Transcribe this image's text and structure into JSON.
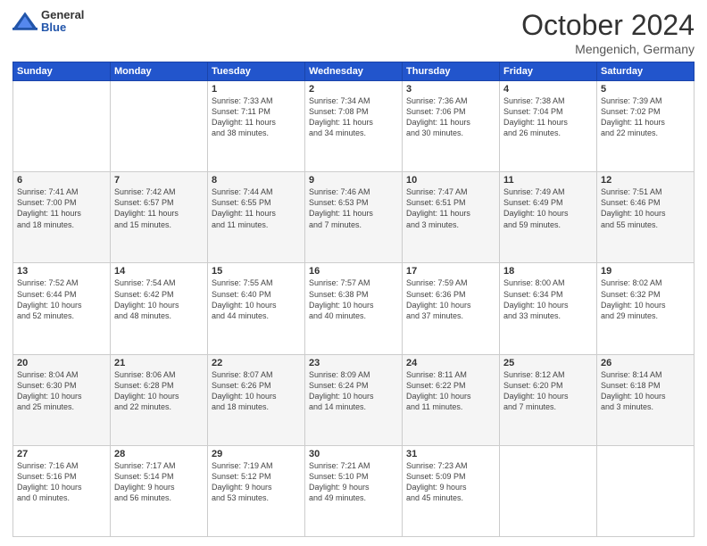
{
  "header": {
    "logo": {
      "general": "General",
      "blue": "Blue"
    },
    "title": "October 2024",
    "location": "Mengenich, Germany"
  },
  "weekdays": [
    "Sunday",
    "Monday",
    "Tuesday",
    "Wednesday",
    "Thursday",
    "Friday",
    "Saturday"
  ],
  "weeks": [
    [
      {
        "day": "",
        "info": ""
      },
      {
        "day": "",
        "info": ""
      },
      {
        "day": "1",
        "info": "Sunrise: 7:33 AM\nSunset: 7:11 PM\nDaylight: 11 hours\nand 38 minutes."
      },
      {
        "day": "2",
        "info": "Sunrise: 7:34 AM\nSunset: 7:08 PM\nDaylight: 11 hours\nand 34 minutes."
      },
      {
        "day": "3",
        "info": "Sunrise: 7:36 AM\nSunset: 7:06 PM\nDaylight: 11 hours\nand 30 minutes."
      },
      {
        "day": "4",
        "info": "Sunrise: 7:38 AM\nSunset: 7:04 PM\nDaylight: 11 hours\nand 26 minutes."
      },
      {
        "day": "5",
        "info": "Sunrise: 7:39 AM\nSunset: 7:02 PM\nDaylight: 11 hours\nand 22 minutes."
      }
    ],
    [
      {
        "day": "6",
        "info": "Sunrise: 7:41 AM\nSunset: 7:00 PM\nDaylight: 11 hours\nand 18 minutes."
      },
      {
        "day": "7",
        "info": "Sunrise: 7:42 AM\nSunset: 6:57 PM\nDaylight: 11 hours\nand 15 minutes."
      },
      {
        "day": "8",
        "info": "Sunrise: 7:44 AM\nSunset: 6:55 PM\nDaylight: 11 hours\nand 11 minutes."
      },
      {
        "day": "9",
        "info": "Sunrise: 7:46 AM\nSunset: 6:53 PM\nDaylight: 11 hours\nand 7 minutes."
      },
      {
        "day": "10",
        "info": "Sunrise: 7:47 AM\nSunset: 6:51 PM\nDaylight: 11 hours\nand 3 minutes."
      },
      {
        "day": "11",
        "info": "Sunrise: 7:49 AM\nSunset: 6:49 PM\nDaylight: 10 hours\nand 59 minutes."
      },
      {
        "day": "12",
        "info": "Sunrise: 7:51 AM\nSunset: 6:46 PM\nDaylight: 10 hours\nand 55 minutes."
      }
    ],
    [
      {
        "day": "13",
        "info": "Sunrise: 7:52 AM\nSunset: 6:44 PM\nDaylight: 10 hours\nand 52 minutes."
      },
      {
        "day": "14",
        "info": "Sunrise: 7:54 AM\nSunset: 6:42 PM\nDaylight: 10 hours\nand 48 minutes."
      },
      {
        "day": "15",
        "info": "Sunrise: 7:55 AM\nSunset: 6:40 PM\nDaylight: 10 hours\nand 44 minutes."
      },
      {
        "day": "16",
        "info": "Sunrise: 7:57 AM\nSunset: 6:38 PM\nDaylight: 10 hours\nand 40 minutes."
      },
      {
        "day": "17",
        "info": "Sunrise: 7:59 AM\nSunset: 6:36 PM\nDaylight: 10 hours\nand 37 minutes."
      },
      {
        "day": "18",
        "info": "Sunrise: 8:00 AM\nSunset: 6:34 PM\nDaylight: 10 hours\nand 33 minutes."
      },
      {
        "day": "19",
        "info": "Sunrise: 8:02 AM\nSunset: 6:32 PM\nDaylight: 10 hours\nand 29 minutes."
      }
    ],
    [
      {
        "day": "20",
        "info": "Sunrise: 8:04 AM\nSunset: 6:30 PM\nDaylight: 10 hours\nand 25 minutes."
      },
      {
        "day": "21",
        "info": "Sunrise: 8:06 AM\nSunset: 6:28 PM\nDaylight: 10 hours\nand 22 minutes."
      },
      {
        "day": "22",
        "info": "Sunrise: 8:07 AM\nSunset: 6:26 PM\nDaylight: 10 hours\nand 18 minutes."
      },
      {
        "day": "23",
        "info": "Sunrise: 8:09 AM\nSunset: 6:24 PM\nDaylight: 10 hours\nand 14 minutes."
      },
      {
        "day": "24",
        "info": "Sunrise: 8:11 AM\nSunset: 6:22 PM\nDaylight: 10 hours\nand 11 minutes."
      },
      {
        "day": "25",
        "info": "Sunrise: 8:12 AM\nSunset: 6:20 PM\nDaylight: 10 hours\nand 7 minutes."
      },
      {
        "day": "26",
        "info": "Sunrise: 8:14 AM\nSunset: 6:18 PM\nDaylight: 10 hours\nand 3 minutes."
      }
    ],
    [
      {
        "day": "27",
        "info": "Sunrise: 7:16 AM\nSunset: 5:16 PM\nDaylight: 10 hours\nand 0 minutes."
      },
      {
        "day": "28",
        "info": "Sunrise: 7:17 AM\nSunset: 5:14 PM\nDaylight: 9 hours\nand 56 minutes."
      },
      {
        "day": "29",
        "info": "Sunrise: 7:19 AM\nSunset: 5:12 PM\nDaylight: 9 hours\nand 53 minutes."
      },
      {
        "day": "30",
        "info": "Sunrise: 7:21 AM\nSunset: 5:10 PM\nDaylight: 9 hours\nand 49 minutes."
      },
      {
        "day": "31",
        "info": "Sunrise: 7:23 AM\nSunset: 5:09 PM\nDaylight: 9 hours\nand 45 minutes."
      },
      {
        "day": "",
        "info": ""
      },
      {
        "day": "",
        "info": ""
      }
    ]
  ]
}
